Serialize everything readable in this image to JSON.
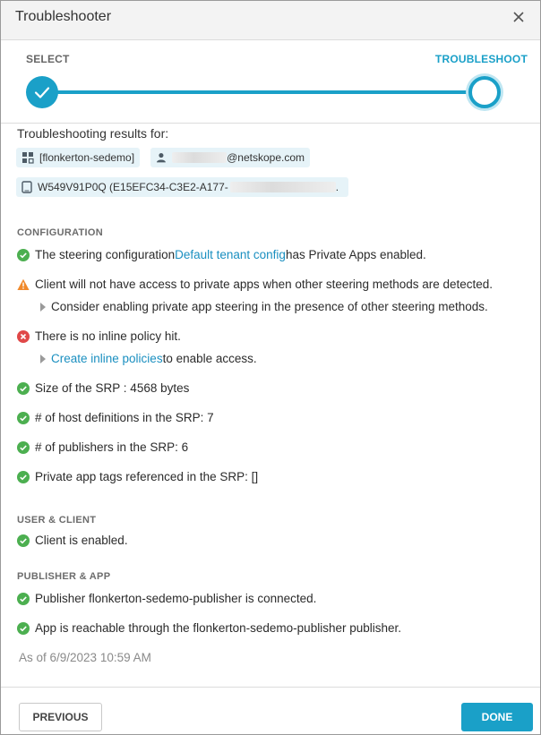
{
  "dialog": {
    "title": "Troubleshooter",
    "close_icon": "close-icon"
  },
  "steps": {
    "select_label": "SELECT",
    "troubleshoot_label": "TROUBLESHOOT",
    "accent": "#1aa0c8"
  },
  "results": {
    "heading": "Troubleshooting results for:",
    "tenant": "[flonkerton-sedemo]",
    "user_suffix": "@netskope.com",
    "device": "W549V91P0Q (E15EFC34-C3E2-A177-",
    "device_suffix": "."
  },
  "configuration": {
    "section_title": "CONFIGURATION",
    "steering_pre": "The steering configuration ",
    "steering_link": "Default tenant config",
    "steering_post": " has Private Apps enabled.",
    "warning": "Client will not have access to private apps when other steering methods are detected.",
    "warning_hint": "Consider enabling private app steering in the presence of other steering methods.",
    "error": "There is no inline policy hit.",
    "error_link": "Create inline policies",
    "error_post": " to enable access.",
    "srp_size": "Size of the SRP : 4568 bytes",
    "host_defs": "# of host definitions in the SRP: 7",
    "publishers": "# of publishers in the SRP: 6",
    "tags": "Private app tags referenced in the SRP: []"
  },
  "user_client": {
    "section_title": "USER & CLIENT",
    "status": "Client is enabled."
  },
  "publisher_app": {
    "section_title": "PUBLISHER & APP",
    "publisher_status": "Publisher flonkerton-sedemo-publisher is connected.",
    "app_status": "App is reachable through the flonkerton-sedemo-publisher publisher."
  },
  "as_of": "As of 6/9/2023 10:59 AM",
  "footer": {
    "previous_label": "PREVIOUS",
    "done_label": "DONE"
  },
  "colors": {
    "success": "#4caf50",
    "warning": "#f0892b",
    "error": "#e04848",
    "link": "#1a8fc0"
  }
}
